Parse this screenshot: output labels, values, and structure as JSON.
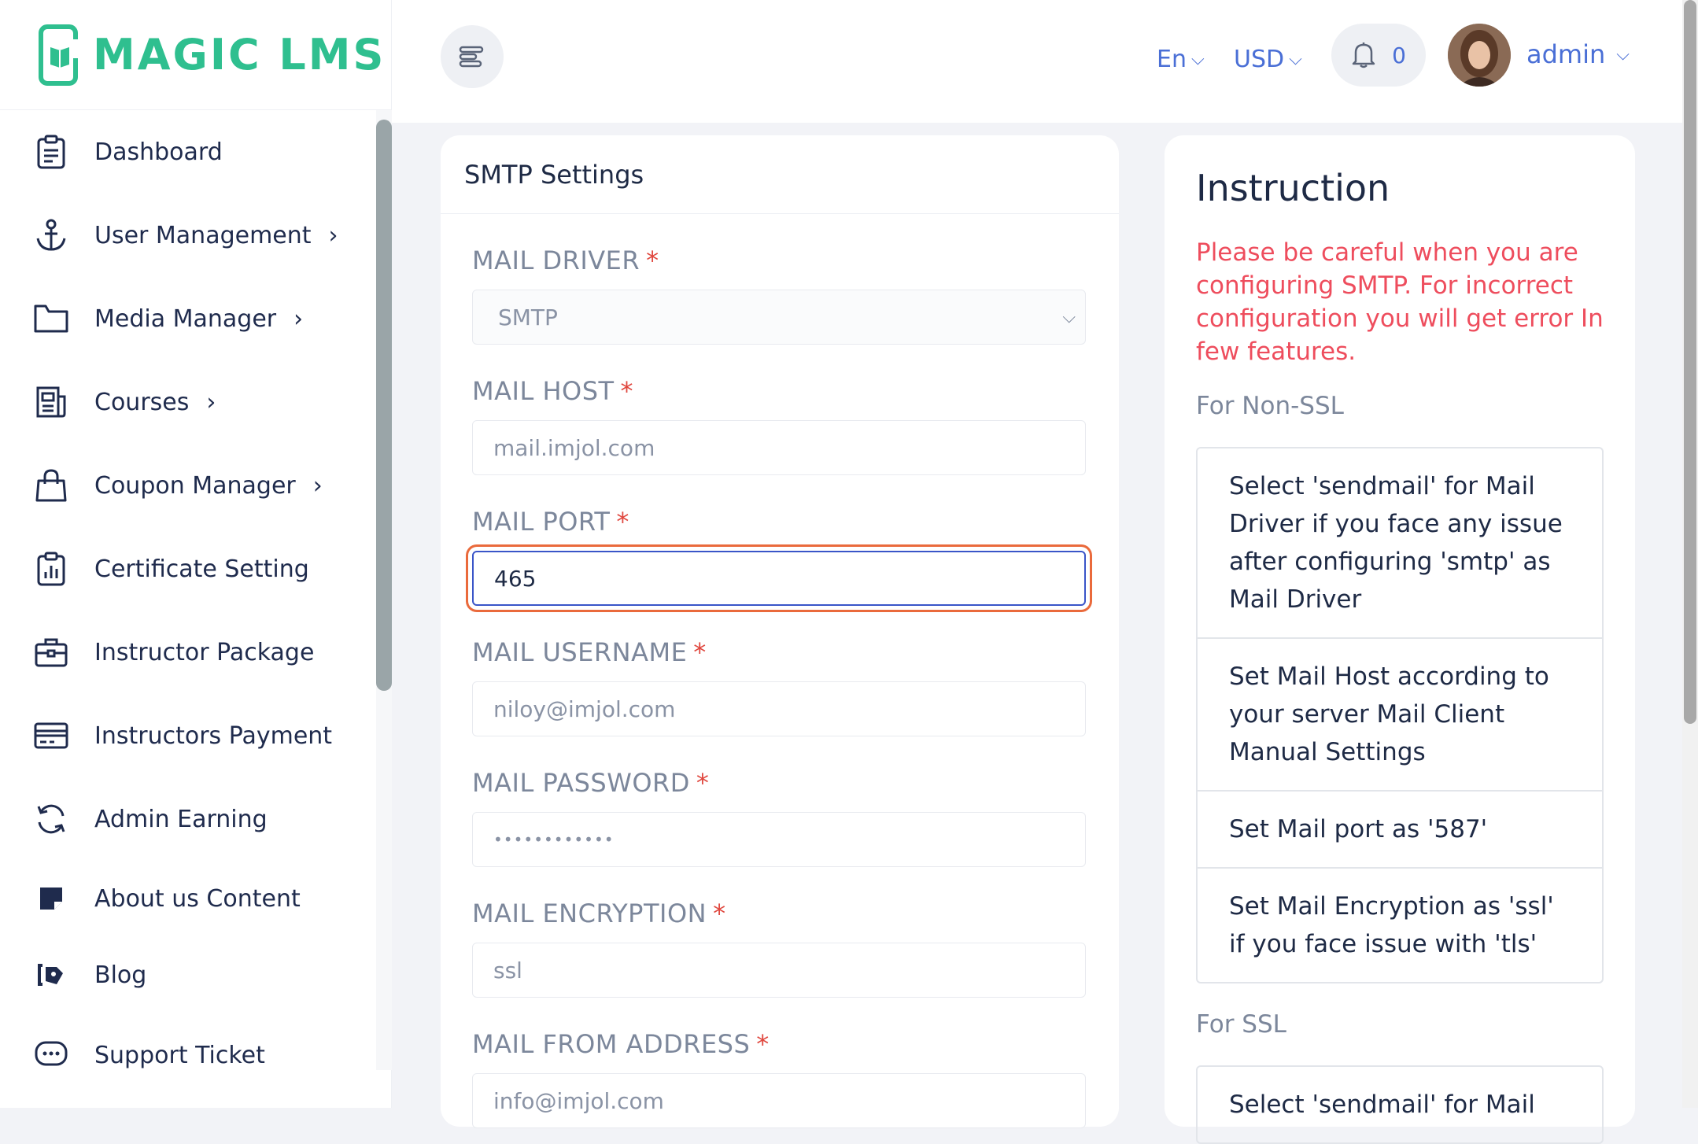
{
  "app": {
    "logo_text": "MAGIC LMS"
  },
  "header": {
    "language": "En",
    "currency": "USD",
    "notification_count": "0",
    "user_name": "admin"
  },
  "sidebar": {
    "items": [
      {
        "label": "Dashboard",
        "icon": "clipboard-icon",
        "has_submenu": false
      },
      {
        "label": "User Management",
        "icon": "anchor-icon",
        "has_submenu": true
      },
      {
        "label": "Media Manager",
        "icon": "folder-icon",
        "has_submenu": true
      },
      {
        "label": "Courses",
        "icon": "newspaper-icon",
        "has_submenu": true
      },
      {
        "label": "Coupon Manager",
        "icon": "shopping-bag-icon",
        "has_submenu": true
      },
      {
        "label": "Certificate Setting",
        "icon": "clipboard-chart-icon",
        "has_submenu": false
      },
      {
        "label": "Instructor Package",
        "icon": "briefcase-icon",
        "has_submenu": false
      },
      {
        "label": "Instructors Payment",
        "icon": "credit-card-icon",
        "has_submenu": false
      },
      {
        "label": "Admin Earning",
        "icon": "refresh-icon",
        "has_submenu": false
      },
      {
        "label": "About us Content",
        "icon": "sticky-note-icon",
        "has_submenu": false
      },
      {
        "label": "Blog",
        "icon": "blog-icon",
        "has_submenu": false
      },
      {
        "label": "Support Ticket",
        "icon": "chat-dots-icon",
        "has_submenu": false
      }
    ]
  },
  "smtp": {
    "title": "SMTP Settings",
    "fields": {
      "driver": {
        "label": "MAIL DRIVER",
        "value": "SMTP"
      },
      "host": {
        "label": "MAIL HOST",
        "value": "mail.imjol.com"
      },
      "port": {
        "label": "MAIL PORT",
        "value": "465"
      },
      "username": {
        "label": "MAIL USERNAME",
        "value": "niloy@imjol.com"
      },
      "password": {
        "label": "MAIL PASSWORD",
        "value": "••••••••••••"
      },
      "encryption": {
        "label": "MAIL ENCRYPTION",
        "value": "ssl"
      },
      "from_address": {
        "label": "MAIL FROM ADDRESS",
        "value": "info@imjol.com"
      }
    },
    "required_mark": "*"
  },
  "instruction": {
    "title": "Instruction",
    "warning": "Please be careful when you are configuring SMTP. For incorrect configuration you will get error In few features.",
    "non_ssl_heading": "For Non-SSL",
    "non_ssl_items": [
      "Select 'sendmail' for Mail Driver if you face any issue after configuring 'smtp' as Mail Driver",
      "Set Mail Host according to your server Mail Client Manual Settings",
      "Set Mail port as '587'",
      "Set Mail Encryption as 'ssl' if you face issue with 'tls'"
    ],
    "ssl_heading": "For SSL",
    "ssl_items": [
      "Select 'sendmail' for Mail"
    ]
  },
  "colors": {
    "brand": "#2fbf8f",
    "accent": "#4a6fd6",
    "warning": "#ee4d5d",
    "focus_ring": "#ea6a3c"
  }
}
